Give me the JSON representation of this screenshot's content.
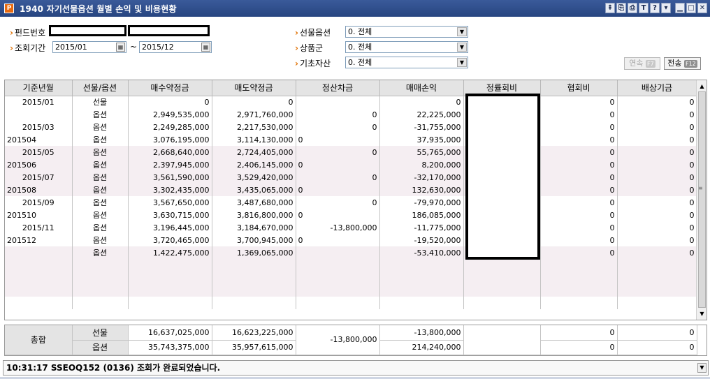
{
  "window": {
    "title": "1940 자기선물옵션 월별 손익 및 비용현황",
    "app_icon": "P",
    "toolbar_icons": [
      "pin-icon",
      "copy-icon",
      "print-icon",
      "text-icon",
      "help-icon",
      "menu-icon",
      "minimize-icon",
      "maximize-icon",
      "close-icon"
    ],
    "toolbar_glyphs": [
      "⇞",
      "⎘",
      "⎙",
      "T",
      "?",
      "▾",
      "▁",
      "□",
      "✕"
    ]
  },
  "form": {
    "fund_label": "펀드번호",
    "period_label": "조회기간",
    "date_from": "2015/01",
    "date_to": "2015/12",
    "tilde": "~",
    "futopt_label": "선물옵션",
    "futopt_value": "0. 전체",
    "product_label": "상품군",
    "product_value": "0. 전체",
    "underlying_label": "기초자산",
    "underlying_value": "0. 전체",
    "next_label": "연속",
    "next_key": "F7",
    "send_label": "전송",
    "send_key": "F12"
  },
  "grid": {
    "headers": [
      "기준년월",
      "선물/옵션",
      "매수약정금",
      "매도약정금",
      "정산차금",
      "매매손익",
      "정률회비",
      "협회비",
      "배상기금"
    ],
    "rows": [
      {
        "ym": "2015/01",
        "ym_align": "c",
        "type": "선물",
        "buy": "0",
        "sell": "0",
        "settle": "",
        "pnl": "0",
        "fee": "",
        "assoc": "0",
        "comp": "0",
        "shade": false
      },
      {
        "ym": "",
        "ym_align": "c",
        "type": "옵션",
        "buy": "2,949,535,000",
        "sell": "2,971,760,000",
        "settle": "0",
        "pnl": "22,225,000",
        "fee": "",
        "assoc": "0",
        "comp": "0",
        "shade": false
      },
      {
        "ym": "2015/03",
        "ym_align": "c",
        "type": "옵션",
        "buy": "2,249,285,000",
        "sell": "2,217,530,000",
        "settle": "0",
        "pnl": "-31,755,000",
        "fee": "",
        "assoc": "0",
        "comp": "0",
        "shade": false
      },
      {
        "ym": "201504",
        "ym_align": "l",
        "type": "옵션",
        "buy": "3,076,195,000",
        "sell": "3,114,130,000",
        "settle": "0",
        "settle_align": "l",
        "pnl": "37,935,000",
        "fee": "",
        "assoc": "0",
        "comp": "0",
        "shade": false
      },
      {
        "ym": "2015/05",
        "ym_align": "c",
        "type": "옵션",
        "buy": "2,668,640,000",
        "sell": "2,724,405,000",
        "settle": "0",
        "pnl": "55,765,000",
        "fee": "",
        "assoc": "0",
        "comp": "0",
        "shade": true
      },
      {
        "ym": "201506",
        "ym_align": "l",
        "type": "옵션",
        "buy": "2,397,945,000",
        "sell": "2,406,145,000",
        "settle": "0",
        "settle_align": "l",
        "pnl": "8,200,000",
        "fee": "",
        "assoc": "0",
        "comp": "0",
        "shade": true
      },
      {
        "ym": "2015/07",
        "ym_align": "c",
        "type": "옵션",
        "buy": "3,561,590,000",
        "sell": "3,529,420,000",
        "settle": "0",
        "pnl": "-32,170,000",
        "fee": "",
        "assoc": "0",
        "comp": "0",
        "shade": true
      },
      {
        "ym": "201508",
        "ym_align": "l",
        "type": "옵션",
        "buy": "3,302,435,000",
        "sell": "3,435,065,000",
        "settle": "0",
        "settle_align": "l",
        "pnl": "132,630,000",
        "fee": "",
        "assoc": "0",
        "comp": "0",
        "shade": true
      },
      {
        "ym": "2015/09",
        "ym_align": "c",
        "type": "옵션",
        "buy": "3,567,650,000",
        "sell": "3,487,680,000",
        "settle": "0",
        "pnl": "-79,970,000",
        "fee": "",
        "assoc": "0",
        "comp": "0",
        "shade": false
      },
      {
        "ym": "201510",
        "ym_align": "l",
        "type": "옵션",
        "buy": "3,630,715,000",
        "sell": "3,816,800,000",
        "settle": "0",
        "settle_align": "l",
        "pnl": "186,085,000",
        "fee": "",
        "assoc": "0",
        "comp": "0",
        "shade": false
      },
      {
        "ym": "2015/11",
        "ym_align": "c",
        "type": "옵션",
        "buy": "3,196,445,000",
        "sell": "3,184,670,000",
        "settle": "-13,800,000",
        "pnl": "-11,775,000",
        "fee": "",
        "assoc": "0",
        "comp": "0",
        "shade": false
      },
      {
        "ym": "201512",
        "ym_align": "l",
        "type": "옵션",
        "buy": "3,720,465,000",
        "sell": "3,700,945,000",
        "settle": "0",
        "settle_align": "l",
        "pnl": "-19,520,000",
        "fee": "",
        "assoc": "0",
        "comp": "0",
        "shade": false
      },
      {
        "ym": "",
        "ym_align": "c",
        "type": "옵션",
        "buy": "1,422,475,000",
        "sell": "1,369,065,000",
        "settle": "",
        "pnl": "-53,410,000",
        "fee": "",
        "assoc": "0",
        "comp": "0",
        "shade": true
      }
    ]
  },
  "summary": {
    "label": "총합",
    "fut_label": "선물",
    "opt_label": "옵션",
    "fut_buy": "16,637,025,000",
    "fut_sell": "16,623,225,000",
    "opt_buy": "35,743,375,000",
    "opt_sell": "35,957,615,000",
    "settle": "-13,800,000",
    "fut_pnl": "-13,800,000",
    "opt_pnl": "214,240,000",
    "fut_assoc": "0",
    "fut_comp": "0",
    "opt_assoc": "0",
    "opt_comp": "0"
  },
  "status": {
    "message": "10:31:17 SSEOQ152 (0136) 조회가 완료되었습니다."
  }
}
